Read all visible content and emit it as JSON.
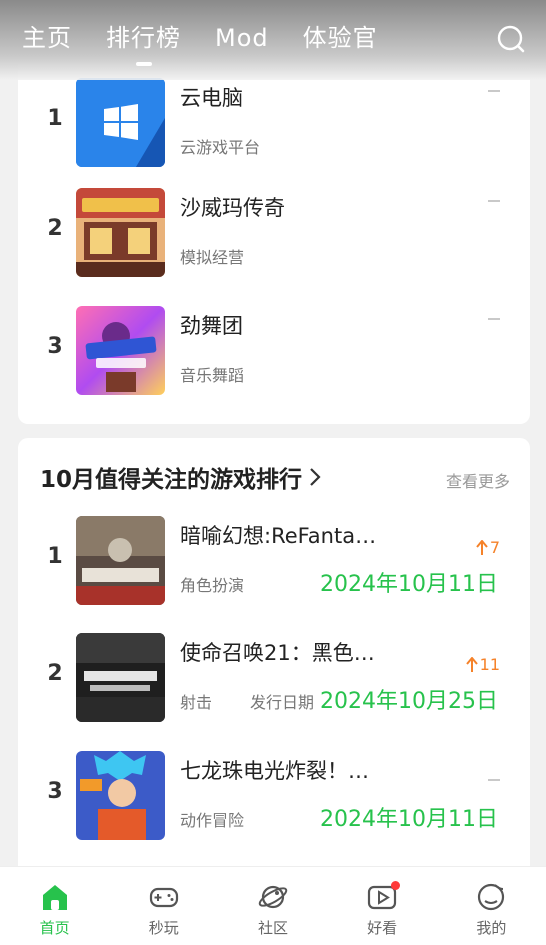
{
  "header": {
    "tabs": [
      {
        "label": "主页"
      },
      {
        "label": "排行榜"
      },
      {
        "label": "Mod"
      },
      {
        "label": "体验官"
      }
    ]
  },
  "list1": [
    {
      "rank": "1",
      "name": "云电脑",
      "genre": "云游戏平台"
    },
    {
      "rank": "2",
      "name": "沙威玛传奇",
      "genre": "模拟经营"
    },
    {
      "rank": "3",
      "name": "劲舞团",
      "genre": "音乐舞蹈"
    }
  ],
  "section2": {
    "title": "10月值得关注的游戏排行",
    "more": "查看更多",
    "items": [
      {
        "rank": "1",
        "name": "暗喻幻想:ReFanta…",
        "genre": "角色扮演",
        "trend": "7",
        "date": "2024年10月11日"
      },
      {
        "rank": "2",
        "name": "使命召唤21：黑色…",
        "genre": "射击",
        "date_label": "发行日期",
        "trend": "11",
        "date": "2024年10月25日"
      },
      {
        "rank": "3",
        "name": "七龙珠电光炸裂！…",
        "genre": "动作冒险",
        "date": "2024年10月11日"
      }
    ]
  },
  "nav": [
    {
      "label": "首页",
      "icon": "home-icon"
    },
    {
      "label": "秒玩",
      "icon": "gamepad-icon"
    },
    {
      "label": "社区",
      "icon": "planet-icon"
    },
    {
      "label": "好看",
      "icon": "video-icon"
    },
    {
      "label": "我的",
      "icon": "profile-icon"
    }
  ],
  "colors": {
    "accent": "#27c24c",
    "trend": "#f5822a",
    "badge": "#ff3b3b"
  }
}
